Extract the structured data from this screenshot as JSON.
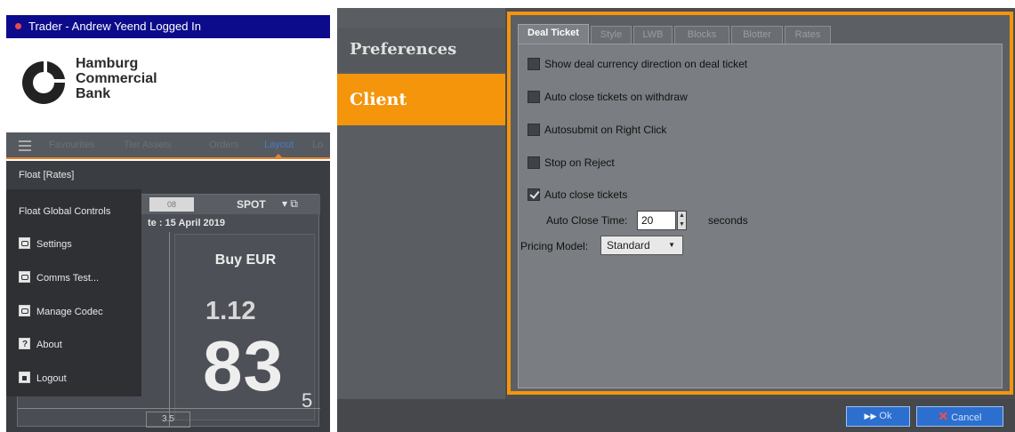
{
  "left": {
    "title": "Trader - Andrew Yeend Logged In",
    "brand": {
      "line1": "Hamburg",
      "line2": "Commercial",
      "line3": "Bank"
    },
    "nav": {
      "tabs": [
        "Favourites",
        "Tier Assets",
        "Orders",
        "Layout",
        "Lo"
      ]
    },
    "tile": {
      "tenor": "08",
      "spot": "SPOT",
      "date": "te : 15 April 2019",
      "buy_label": "Buy EUR",
      "big_figure": "1.12",
      "pips": "83",
      "fraction": "5",
      "spread": "3.5"
    },
    "menu": {
      "items": [
        {
          "label": "Float [Rates]",
          "icon": ""
        },
        {
          "label": "Float Global Controls",
          "icon": ""
        },
        {
          "label": "Settings",
          "icon": "link-icon"
        },
        {
          "label": "Comms Test...",
          "icon": "link-icon"
        },
        {
          "label": "Manage Codec",
          "icon": "link-icon"
        },
        {
          "label": "About",
          "icon": "question-icon"
        },
        {
          "label": "Logout",
          "icon": "lock-icon"
        }
      ]
    }
  },
  "right": {
    "sidebar": {
      "preferences": "Preferences",
      "client": "Client"
    },
    "tabs": [
      "Deal Ticket",
      "Style",
      "LWB",
      "Blocks",
      "Blotter",
      "Rates"
    ],
    "options": [
      {
        "label": "Show deal currency direction on deal ticket",
        "checked": false
      },
      {
        "label": "Auto close tickets on withdraw",
        "checked": false
      },
      {
        "label": "Autosubmit on Right Click",
        "checked": false
      },
      {
        "label": "Stop on Reject",
        "checked": false
      },
      {
        "label": "Auto close tickets",
        "checked": true
      }
    ],
    "auto_close_time": {
      "label": "Auto Close Time:",
      "value": "20",
      "unit": "seconds"
    },
    "pricing_model": {
      "label": "Pricing Model:",
      "value": "Standard"
    },
    "buttons": {
      "ok": "Ok",
      "cancel": "Cancel"
    }
  },
  "colors": {
    "accent_orange": "#f4950b",
    "title_blue": "#0b0b8c",
    "button_blue": "#2c6fcf"
  }
}
